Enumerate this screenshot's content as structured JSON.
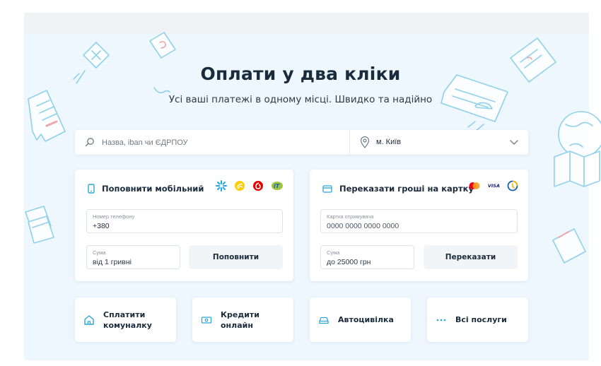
{
  "hero": {
    "title": "Оплати у два кліки",
    "subtitle": "Усі ваші платежі в одному місці. Швидко та надійно"
  },
  "search": {
    "placeholder": "Назва, iban чи ЄДРПОУ",
    "city": "м. Київ"
  },
  "mobile": {
    "title": "Поповнити мобільний",
    "operators": [
      "kyivstar-icon",
      "lifecell-icon",
      "vodafone-icon",
      "intertelecom-icon"
    ],
    "phone_label": "Номер телефону",
    "phone_value": "+380",
    "amount_label": "Сума",
    "amount_placeholder": "від 1 гривні",
    "button": "Поповнити"
  },
  "transfer": {
    "title": "Переказати гроші на картку",
    "card_brands": [
      "mastercard-icon",
      "visa-icon",
      "prostir-icon"
    ],
    "visa_text": "VISA",
    "card_label": "Картка отримувача",
    "card_placeholder": "0000 0000 0000 0000",
    "amount_label": "Сума",
    "amount_placeholder": "до 25000 грн",
    "button": "Переказати"
  },
  "services": [
    {
      "label_line1": "Сплатити",
      "label_line2": "комуналку",
      "icon": "house-icon"
    },
    {
      "label": "Кредити онлайн",
      "icon": "banknote-icon"
    },
    {
      "label": "Автоцивілка",
      "icon": "car-icon"
    },
    {
      "label": "Всі послуги",
      "icon": "dots-icon"
    }
  ],
  "colors": {
    "accent": "#2aa6d5",
    "text": "#1a2b3c",
    "background": "#eef7fd"
  }
}
